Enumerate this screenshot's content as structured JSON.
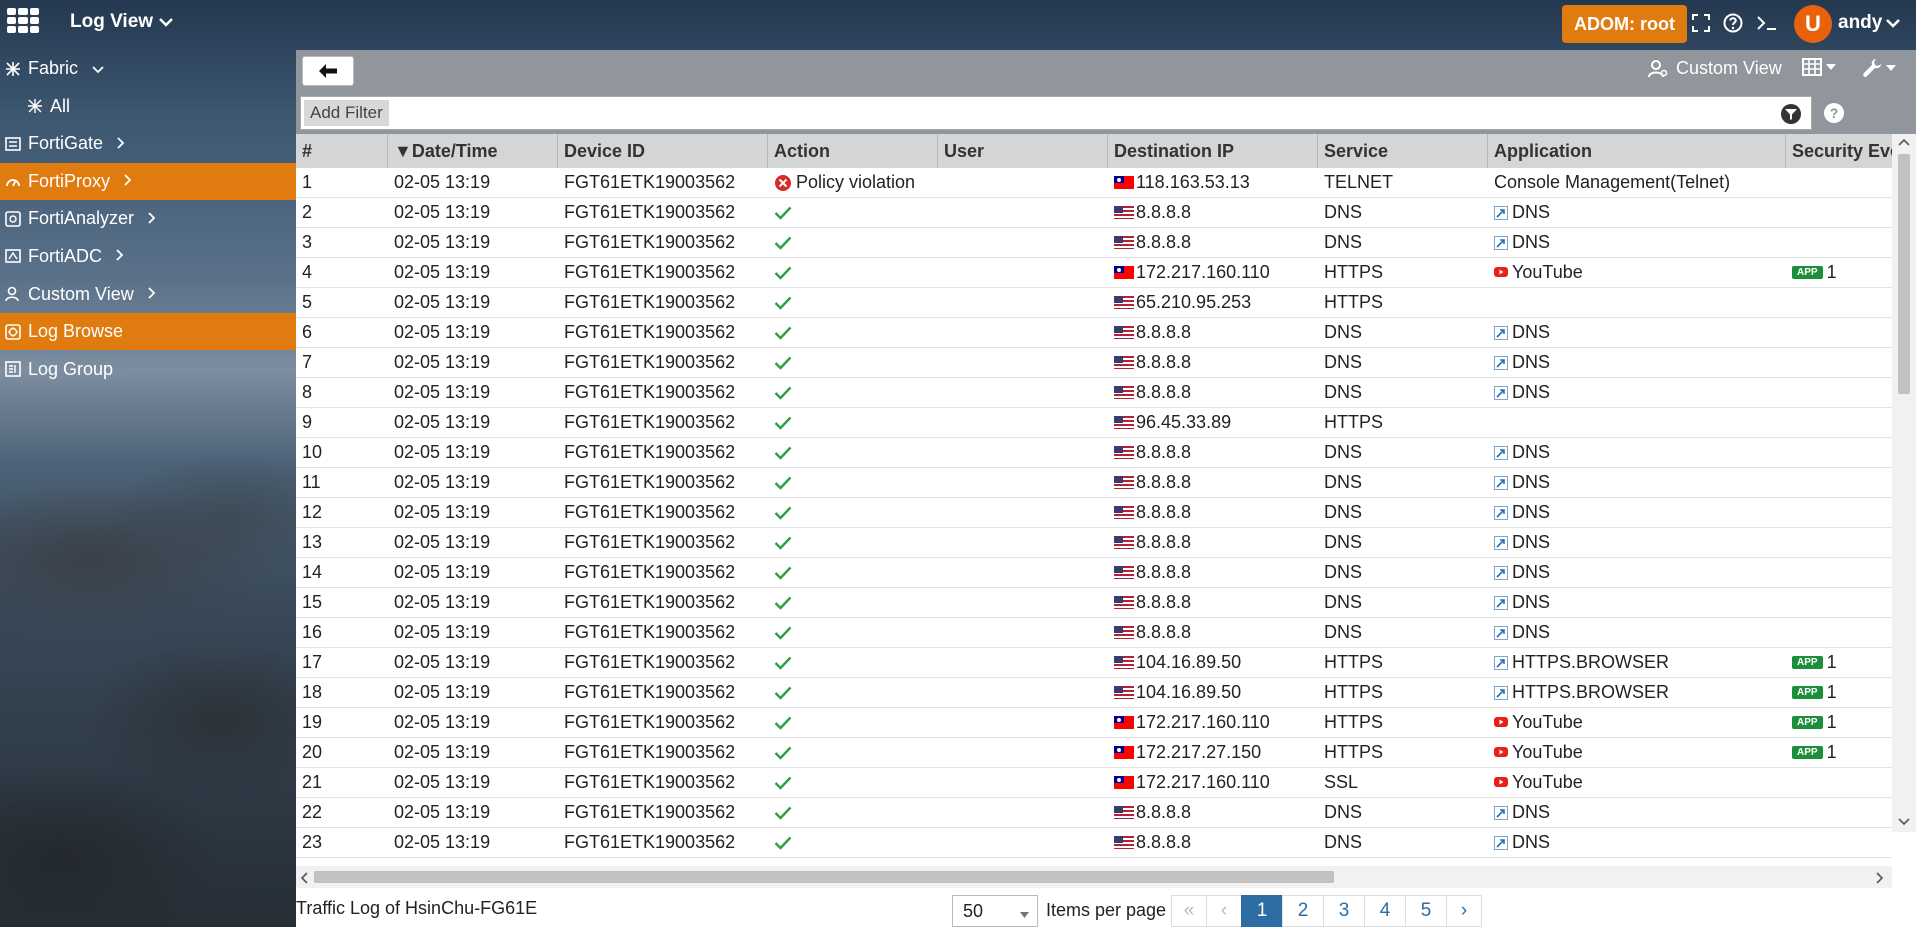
{
  "header": {
    "app_title": "Log View",
    "adom_label": "ADOM: root",
    "avatar_initial": "U",
    "username": "andy"
  },
  "sidebar": {
    "items": [
      {
        "label": "Fabric",
        "icon": "fabric-icon",
        "chevron": "down",
        "sub": false,
        "active": false
      },
      {
        "label": "All",
        "icon": "all-icon",
        "chevron": "",
        "sub": true,
        "active": false
      },
      {
        "label": "FortiGate",
        "icon": "fortigate-icon",
        "chevron": "right",
        "sub": false,
        "active": false
      },
      {
        "label": "FortiProxy",
        "icon": "fortiproxy-icon",
        "chevron": "right",
        "sub": false,
        "active": true
      },
      {
        "label": "FortiAnalyzer",
        "icon": "fortianalyzer-icon",
        "chevron": "right",
        "sub": false,
        "active": false
      },
      {
        "label": "FortiADC",
        "icon": "fortiadc-icon",
        "chevron": "right",
        "sub": false,
        "active": false
      },
      {
        "label": "Custom View",
        "icon": "custom-view-icon",
        "chevron": "right",
        "sub": false,
        "active": false
      },
      {
        "label": "Log Browse",
        "icon": "log-browse-icon",
        "chevron": "",
        "sub": false,
        "active": true
      },
      {
        "label": "Log Group",
        "icon": "log-group-icon",
        "chevron": "",
        "sub": false,
        "active": false
      }
    ]
  },
  "toolbar": {
    "custom_view_label": "Custom View"
  },
  "filter": {
    "add_filter_label": "Add Filter"
  },
  "table": {
    "columns": [
      {
        "label": "#",
        "width": 92
      },
      {
        "label": "▼Date/Time",
        "width": 170
      },
      {
        "label": "Device ID",
        "width": 210
      },
      {
        "label": "Action",
        "width": 170
      },
      {
        "label": "User",
        "width": 170
      },
      {
        "label": "Destination IP",
        "width": 210
      },
      {
        "label": "Service",
        "width": 170
      },
      {
        "label": "Application",
        "width": 298
      },
      {
        "label": "Security Event L",
        "width": 210
      }
    ],
    "rows": [
      {
        "n": "1",
        "dt": "02-05 13:19",
        "dev": "FGT61ETK19003562",
        "action": "Policy violation",
        "action_type": "deny",
        "user": "",
        "flag": "tw",
        "ip": "118.163.53.13",
        "service": "TELNET",
        "app": "Console Management(Telnet)",
        "app_icon": "",
        "badge": "",
        "sec": ""
      },
      {
        "n": "2",
        "dt": "02-05 13:19",
        "dev": "FGT61ETK19003562",
        "action": "",
        "action_type": "accept",
        "user": "",
        "flag": "us",
        "ip": "8.8.8.8",
        "service": "DNS",
        "app": "DNS",
        "app_icon": "dns",
        "badge": "",
        "sec": ""
      },
      {
        "n": "3",
        "dt": "02-05 13:19",
        "dev": "FGT61ETK19003562",
        "action": "",
        "action_type": "accept",
        "user": "",
        "flag": "us",
        "ip": "8.8.8.8",
        "service": "DNS",
        "app": "DNS",
        "app_icon": "dns",
        "badge": "",
        "sec": ""
      },
      {
        "n": "4",
        "dt": "02-05 13:19",
        "dev": "FGT61ETK19003562",
        "action": "",
        "action_type": "accept",
        "user": "",
        "flag": "tw",
        "ip": "172.217.160.110",
        "service": "HTTPS",
        "app": "YouTube",
        "app_icon": "youtube",
        "badge": "APP",
        "sec": "1"
      },
      {
        "n": "5",
        "dt": "02-05 13:19",
        "dev": "FGT61ETK19003562",
        "action": "",
        "action_type": "accept",
        "user": "",
        "flag": "us",
        "ip": "65.210.95.253",
        "service": "HTTPS",
        "app": "",
        "app_icon": "",
        "badge": "",
        "sec": ""
      },
      {
        "n": "6",
        "dt": "02-05 13:19",
        "dev": "FGT61ETK19003562",
        "action": "",
        "action_type": "accept",
        "user": "",
        "flag": "us",
        "ip": "8.8.8.8",
        "service": "DNS",
        "app": "DNS",
        "app_icon": "dns",
        "badge": "",
        "sec": ""
      },
      {
        "n": "7",
        "dt": "02-05 13:19",
        "dev": "FGT61ETK19003562",
        "action": "",
        "action_type": "accept",
        "user": "",
        "flag": "us",
        "ip": "8.8.8.8",
        "service": "DNS",
        "app": "DNS",
        "app_icon": "dns",
        "badge": "",
        "sec": ""
      },
      {
        "n": "8",
        "dt": "02-05 13:19",
        "dev": "FGT61ETK19003562",
        "action": "",
        "action_type": "accept",
        "user": "",
        "flag": "us",
        "ip": "8.8.8.8",
        "service": "DNS",
        "app": "DNS",
        "app_icon": "dns",
        "badge": "",
        "sec": ""
      },
      {
        "n": "9",
        "dt": "02-05 13:19",
        "dev": "FGT61ETK19003562",
        "action": "",
        "action_type": "accept",
        "user": "",
        "flag": "us",
        "ip": "96.45.33.89",
        "service": "HTTPS",
        "app": "",
        "app_icon": "",
        "badge": "",
        "sec": ""
      },
      {
        "n": "10",
        "dt": "02-05 13:19",
        "dev": "FGT61ETK19003562",
        "action": "",
        "action_type": "accept",
        "user": "",
        "flag": "us",
        "ip": "8.8.8.8",
        "service": "DNS",
        "app": "DNS",
        "app_icon": "dns",
        "badge": "",
        "sec": ""
      },
      {
        "n": "11",
        "dt": "02-05 13:19",
        "dev": "FGT61ETK19003562",
        "action": "",
        "action_type": "accept",
        "user": "",
        "flag": "us",
        "ip": "8.8.8.8",
        "service": "DNS",
        "app": "DNS",
        "app_icon": "dns",
        "badge": "",
        "sec": ""
      },
      {
        "n": "12",
        "dt": "02-05 13:19",
        "dev": "FGT61ETK19003562",
        "action": "",
        "action_type": "accept",
        "user": "",
        "flag": "us",
        "ip": "8.8.8.8",
        "service": "DNS",
        "app": "DNS",
        "app_icon": "dns",
        "badge": "",
        "sec": ""
      },
      {
        "n": "13",
        "dt": "02-05 13:19",
        "dev": "FGT61ETK19003562",
        "action": "",
        "action_type": "accept",
        "user": "",
        "flag": "us",
        "ip": "8.8.8.8",
        "service": "DNS",
        "app": "DNS",
        "app_icon": "dns",
        "badge": "",
        "sec": ""
      },
      {
        "n": "14",
        "dt": "02-05 13:19",
        "dev": "FGT61ETK19003562",
        "action": "",
        "action_type": "accept",
        "user": "",
        "flag": "us",
        "ip": "8.8.8.8",
        "service": "DNS",
        "app": "DNS",
        "app_icon": "dns",
        "badge": "",
        "sec": ""
      },
      {
        "n": "15",
        "dt": "02-05 13:19",
        "dev": "FGT61ETK19003562",
        "action": "",
        "action_type": "accept",
        "user": "",
        "flag": "us",
        "ip": "8.8.8.8",
        "service": "DNS",
        "app": "DNS",
        "app_icon": "dns",
        "badge": "",
        "sec": ""
      },
      {
        "n": "16",
        "dt": "02-05 13:19",
        "dev": "FGT61ETK19003562",
        "action": "",
        "action_type": "accept",
        "user": "",
        "flag": "us",
        "ip": "8.8.8.8",
        "service": "DNS",
        "app": "DNS",
        "app_icon": "dns",
        "badge": "",
        "sec": ""
      },
      {
        "n": "17",
        "dt": "02-05 13:19",
        "dev": "FGT61ETK19003562",
        "action": "",
        "action_type": "accept",
        "user": "",
        "flag": "us",
        "ip": "104.16.89.50",
        "service": "HTTPS",
        "app": "HTTPS.BROWSER",
        "app_icon": "dns",
        "badge": "APP",
        "sec": "1"
      },
      {
        "n": "18",
        "dt": "02-05 13:19",
        "dev": "FGT61ETK19003562",
        "action": "",
        "action_type": "accept",
        "user": "",
        "flag": "us",
        "ip": "104.16.89.50",
        "service": "HTTPS",
        "app": "HTTPS.BROWSER",
        "app_icon": "dns",
        "badge": "APP",
        "sec": "1"
      },
      {
        "n": "19",
        "dt": "02-05 13:19",
        "dev": "FGT61ETK19003562",
        "action": "",
        "action_type": "accept",
        "user": "",
        "flag": "tw",
        "ip": "172.217.160.110",
        "service": "HTTPS",
        "app": "YouTube",
        "app_icon": "youtube",
        "badge": "APP",
        "sec": "1"
      },
      {
        "n": "20",
        "dt": "02-05 13:19",
        "dev": "FGT61ETK19003562",
        "action": "",
        "action_type": "accept",
        "user": "",
        "flag": "tw",
        "ip": "172.217.27.150",
        "service": "HTTPS",
        "app": "YouTube",
        "app_icon": "youtube",
        "badge": "APP",
        "sec": "1"
      },
      {
        "n": "21",
        "dt": "02-05 13:19",
        "dev": "FGT61ETK19003562",
        "action": "",
        "action_type": "accept",
        "user": "",
        "flag": "tw",
        "ip": "172.217.160.110",
        "service": "SSL",
        "app": "YouTube",
        "app_icon": "youtube",
        "badge": "",
        "sec": ""
      },
      {
        "n": "22",
        "dt": "02-05 13:19",
        "dev": "FGT61ETK19003562",
        "action": "",
        "action_type": "accept",
        "user": "",
        "flag": "us",
        "ip": "8.8.8.8",
        "service": "DNS",
        "app": "DNS",
        "app_icon": "dns",
        "badge": "",
        "sec": ""
      },
      {
        "n": "23",
        "dt": "02-05 13:19",
        "dev": "FGT61ETK19003562",
        "action": "",
        "action_type": "accept",
        "user": "",
        "flag": "us",
        "ip": "8.8.8.8",
        "service": "DNS",
        "app": "DNS",
        "app_icon": "dns",
        "badge": "",
        "sec": ""
      }
    ]
  },
  "footer": {
    "title": "Traffic Log of HsinChu-FG61E",
    "per_page_value": "50",
    "per_page_label": "Items per page",
    "pages": [
      "1",
      "2",
      "3",
      "4",
      "5"
    ],
    "current_page": "1",
    "first_symbol": "«",
    "prev_symbol": "‹",
    "next_symbol": "›"
  },
  "colors": {
    "accent": "#e07b10",
    "toolbar": "#90969c",
    "header_row": "#d4d5d6",
    "accept_check": "#2ea043",
    "deny": "#d62b2b",
    "pager_active": "#2e6da4"
  }
}
